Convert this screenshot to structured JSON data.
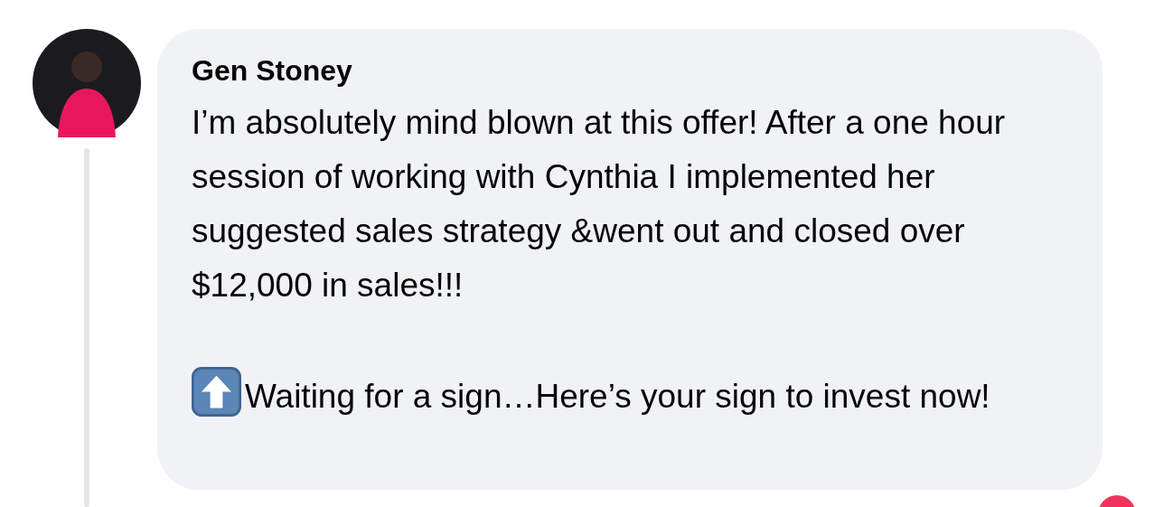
{
  "comment": {
    "author": "Gen Stoney",
    "paragraphs": [
      "I’m absolutely mind blown at this offer! After a one hour session of working with Cynthia I implemented her suggested sales strategy &went out and closed over $12,000 in sales!!!"
    ],
    "closing": "Waiting for a sign…Here’s your sign to invest now!"
  }
}
